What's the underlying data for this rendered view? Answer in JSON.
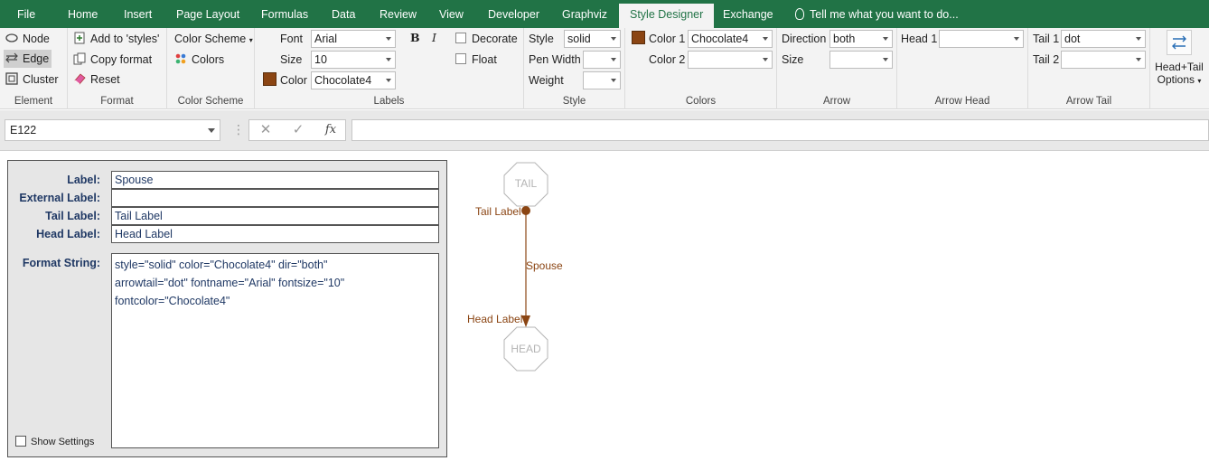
{
  "tabs": [
    {
      "label": "File"
    },
    {
      "label": "Home"
    },
    {
      "label": "Insert"
    },
    {
      "label": "Page Layout"
    },
    {
      "label": "Formulas"
    },
    {
      "label": "Data"
    },
    {
      "label": "Review"
    },
    {
      "label": "View"
    },
    {
      "label": "Developer"
    },
    {
      "label": "Graphviz"
    },
    {
      "label": "Style Designer"
    },
    {
      "label": "Exchange"
    }
  ],
  "tell_me": "Tell me what you want to do...",
  "ribbon": {
    "element": {
      "node": "Node",
      "edge": "Edge",
      "cluster": "Cluster",
      "label": "Element"
    },
    "format": {
      "add": "Add to 'styles'",
      "copy": "Copy format",
      "reset": "Reset",
      "label": "Format"
    },
    "color_scheme": {
      "scheme": "Color Scheme",
      "colors": "Colors",
      "label": "Color Scheme"
    },
    "labels": {
      "font_label": "Font",
      "font_value": "Arial",
      "size_label": "Size",
      "size_value": "10",
      "color_label": "Color",
      "color_value": "Chocolate4",
      "bold": "B",
      "italic": "I",
      "decorate": "Decorate",
      "float": "Float",
      "label": "Labels"
    },
    "style": {
      "style_label": "Style",
      "style_value": "solid",
      "pen_label": "Pen Width",
      "weight_label": "Weight",
      "label": "Style"
    },
    "colors": {
      "color1_label": "Color 1",
      "color1_value": "Chocolate4",
      "color2_label": "Color 2",
      "label": "Colors"
    },
    "arrow": {
      "direction_label": "Direction",
      "direction_value": "both",
      "size_label": "Size",
      "label": "Arrow"
    },
    "arrow_head": {
      "head1_label": "Head 1",
      "label": "Arrow Head"
    },
    "arrow_tail": {
      "tail1_label": "Tail 1",
      "tail1_value": "dot",
      "tail2_label": "Tail 2",
      "label": "Arrow Tail"
    },
    "head_tail_options": {
      "line1": "Head+Tail",
      "line2": "Options"
    },
    "swatch_color": "#8B4513"
  },
  "formula_bar": {
    "name_box": "E122",
    "cancel": "✕",
    "enter": "✓",
    "fx": "fx"
  },
  "panel": {
    "label_label": "Label:",
    "label_value": "Spouse",
    "external_label": "External Label:",
    "external_value": "",
    "tail_label": "Tail Label:",
    "tail_value": "Tail Label",
    "head_label": "Head Label:",
    "head_value": "Head Label",
    "format_label": "Format String:",
    "format_lines": [
      "style=\"solid\" color=\"Chocolate4\" dir=\"both\"",
      "arrowtail=\"dot\" fontname=\"Arial\" fontsize=\"10\"",
      "fontcolor=\"Chocolate4\""
    ],
    "show_settings": "Show Settings"
  },
  "graph": {
    "tail_node": "TAIL",
    "head_node": "HEAD",
    "edge_label": "Spouse",
    "tail_label": "Tail Label",
    "head_label": "Head Label",
    "edge_color": "#8B4513",
    "node_color": "#B4B4B4"
  }
}
